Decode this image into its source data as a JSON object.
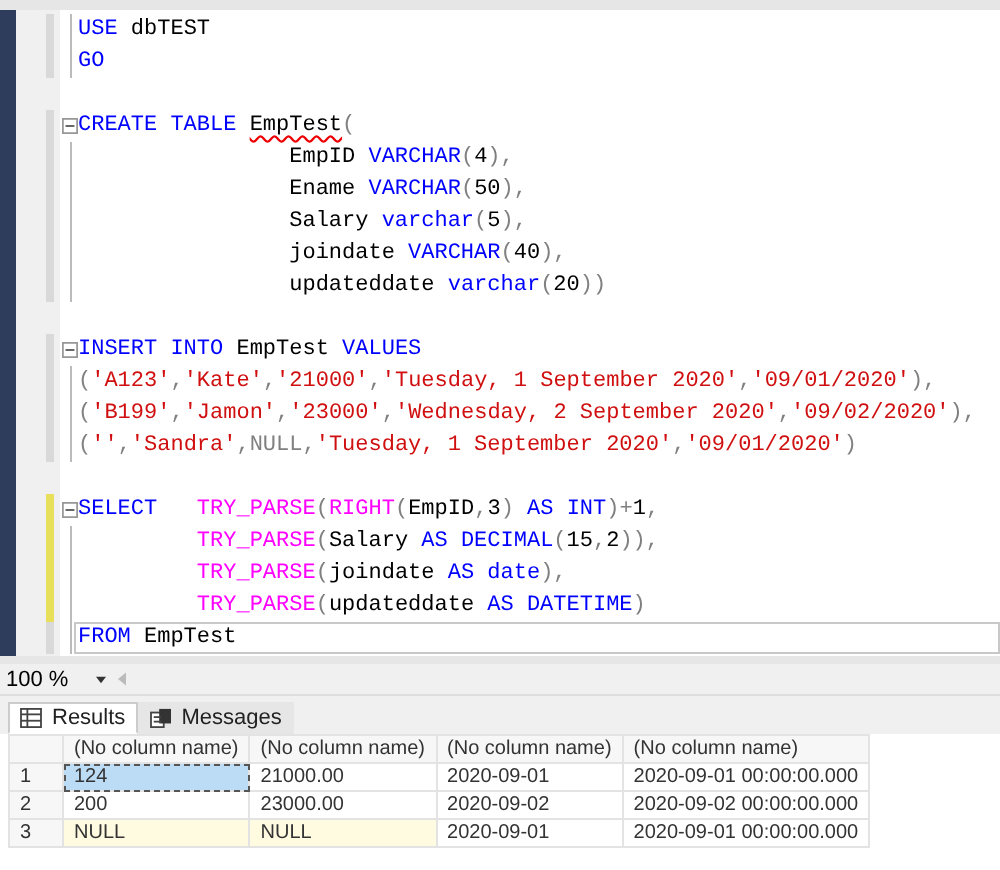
{
  "editor": {
    "blocks": [
      {
        "lines": [
          {
            "fold": false,
            "changed": false,
            "current": false,
            "tokens": [
              {
                "kind": "keyword",
                "text": "USE"
              },
              {
                "kind": "plain",
                "text": " dbTEST"
              }
            ]
          },
          {
            "fold": false,
            "changed": false,
            "current": false,
            "tokens": [
              {
                "kind": "keyword",
                "text": "GO"
              }
            ]
          }
        ]
      },
      {
        "lines": [
          {
            "fold": true,
            "changed": false,
            "current": false,
            "tokens": [
              {
                "kind": "keyword",
                "text": "CREATE TABLE "
              },
              {
                "kind": "error",
                "text": "EmpTest"
              },
              {
                "kind": "operator",
                "text": "("
              }
            ]
          },
          {
            "fold": false,
            "changed": false,
            "current": false,
            "tokens": [
              {
                "kind": "plain",
                "text": "                EmpID "
              },
              {
                "kind": "keyword",
                "text": "VARCHAR"
              },
              {
                "kind": "operator",
                "text": "("
              },
              {
                "kind": "plain",
                "text": "4"
              },
              {
                "kind": "operator",
                "text": "),"
              }
            ]
          },
          {
            "fold": false,
            "changed": false,
            "current": false,
            "tokens": [
              {
                "kind": "plain",
                "text": "                Ename "
              },
              {
                "kind": "keyword",
                "text": "VARCHAR"
              },
              {
                "kind": "operator",
                "text": "("
              },
              {
                "kind": "plain",
                "text": "50"
              },
              {
                "kind": "operator",
                "text": "),"
              }
            ]
          },
          {
            "fold": false,
            "changed": false,
            "current": false,
            "tokens": [
              {
                "kind": "plain",
                "text": "                Salary "
              },
              {
                "kind": "keyword",
                "text": "varchar"
              },
              {
                "kind": "operator",
                "text": "("
              },
              {
                "kind": "plain",
                "text": "5"
              },
              {
                "kind": "operator",
                "text": "),"
              }
            ]
          },
          {
            "fold": false,
            "changed": false,
            "current": false,
            "tokens": [
              {
                "kind": "plain",
                "text": "                joindate "
              },
              {
                "kind": "keyword",
                "text": "VARCHAR"
              },
              {
                "kind": "operator",
                "text": "("
              },
              {
                "kind": "plain",
                "text": "40"
              },
              {
                "kind": "operator",
                "text": "),"
              }
            ]
          },
          {
            "fold": false,
            "changed": false,
            "current": false,
            "tokens": [
              {
                "kind": "plain",
                "text": "                updateddate "
              },
              {
                "kind": "keyword",
                "text": "varchar"
              },
              {
                "kind": "operator",
                "text": "("
              },
              {
                "kind": "plain",
                "text": "20"
              },
              {
                "kind": "operator",
                "text": "))"
              }
            ]
          }
        ]
      },
      {
        "lines": [
          {
            "fold": true,
            "changed": false,
            "current": false,
            "tokens": [
              {
                "kind": "keyword",
                "text": "INSERT INTO"
              },
              {
                "kind": "plain",
                "text": " EmpTest "
              },
              {
                "kind": "keyword",
                "text": "VALUES"
              }
            ]
          },
          {
            "fold": false,
            "changed": false,
            "current": false,
            "tokens": [
              {
                "kind": "operator",
                "text": "("
              },
              {
                "kind": "string",
                "text": "'A123'"
              },
              {
                "kind": "operator",
                "text": ","
              },
              {
                "kind": "string",
                "text": "'Kate'"
              },
              {
                "kind": "operator",
                "text": ","
              },
              {
                "kind": "string",
                "text": "'21000'"
              },
              {
                "kind": "operator",
                "text": ","
              },
              {
                "kind": "string",
                "text": "'Tuesday, 1 September 2020'"
              },
              {
                "kind": "operator",
                "text": ","
              },
              {
                "kind": "string",
                "text": "'09/01/2020'"
              },
              {
                "kind": "operator",
                "text": "),"
              }
            ]
          },
          {
            "fold": false,
            "changed": false,
            "current": false,
            "tokens": [
              {
                "kind": "operator",
                "text": "("
              },
              {
                "kind": "string",
                "text": "'B199'"
              },
              {
                "kind": "operator",
                "text": ","
              },
              {
                "kind": "string",
                "text": "'Jamon'"
              },
              {
                "kind": "operator",
                "text": ","
              },
              {
                "kind": "string",
                "text": "'23000'"
              },
              {
                "kind": "operator",
                "text": ","
              },
              {
                "kind": "string",
                "text": "'Wednesday, 2 September 2020'"
              },
              {
                "kind": "operator",
                "text": ","
              },
              {
                "kind": "string",
                "text": "'09/02/2020'"
              },
              {
                "kind": "operator",
                "text": "),"
              }
            ]
          },
          {
            "fold": false,
            "changed": false,
            "current": false,
            "tokens": [
              {
                "kind": "operator",
                "text": "("
              },
              {
                "kind": "string",
                "text": "''"
              },
              {
                "kind": "operator",
                "text": ","
              },
              {
                "kind": "string",
                "text": "'Sandra'"
              },
              {
                "kind": "operator",
                "text": ",NULL,"
              },
              {
                "kind": "string",
                "text": "'Tuesday, 1 September 2020'"
              },
              {
                "kind": "operator",
                "text": ","
              },
              {
                "kind": "string",
                "text": "'09/01/2020'"
              },
              {
                "kind": "operator",
                "text": ")"
              }
            ]
          }
        ]
      },
      {
        "lines": [
          {
            "fold": true,
            "changed": true,
            "current": false,
            "tokens": [
              {
                "kind": "keyword",
                "text": "SELECT   "
              },
              {
                "kind": "function",
                "text": "TRY_PARSE"
              },
              {
                "kind": "operator",
                "text": "("
              },
              {
                "kind": "function",
                "text": "RIGHT"
              },
              {
                "kind": "operator",
                "text": "("
              },
              {
                "kind": "plain",
                "text": "EmpID"
              },
              {
                "kind": "operator",
                "text": ","
              },
              {
                "kind": "plain",
                "text": "3"
              },
              {
                "kind": "operator",
                "text": ") "
              },
              {
                "kind": "keyword",
                "text": "AS INT"
              },
              {
                "kind": "operator",
                "text": ")+"
              },
              {
                "kind": "plain",
                "text": "1"
              },
              {
                "kind": "operator",
                "text": ","
              }
            ]
          },
          {
            "fold": false,
            "changed": true,
            "current": false,
            "tokens": [
              {
                "kind": "function",
                "text": "         TRY_PARSE"
              },
              {
                "kind": "operator",
                "text": "("
              },
              {
                "kind": "plain",
                "text": "Salary "
              },
              {
                "kind": "keyword",
                "text": "AS DECIMAL"
              },
              {
                "kind": "operator",
                "text": "("
              },
              {
                "kind": "plain",
                "text": "15"
              },
              {
                "kind": "operator",
                "text": ","
              },
              {
                "kind": "plain",
                "text": "2"
              },
              {
                "kind": "operator",
                "text": ")),"
              }
            ]
          },
          {
            "fold": false,
            "changed": true,
            "current": false,
            "tokens": [
              {
                "kind": "function",
                "text": "         TRY_PARSE"
              },
              {
                "kind": "operator",
                "text": "("
              },
              {
                "kind": "plain",
                "text": "joindate "
              },
              {
                "kind": "keyword",
                "text": "AS date"
              },
              {
                "kind": "operator",
                "text": "),"
              }
            ]
          },
          {
            "fold": false,
            "changed": true,
            "current": false,
            "tokens": [
              {
                "kind": "function",
                "text": "         TRY_PARSE"
              },
              {
                "kind": "operator",
                "text": "("
              },
              {
                "kind": "plain",
                "text": "updateddate "
              },
              {
                "kind": "keyword",
                "text": "AS DATETIME"
              },
              {
                "kind": "operator",
                "text": ")"
              }
            ]
          },
          {
            "fold": false,
            "changed": false,
            "current": true,
            "tokens": [
              {
                "kind": "keyword",
                "text": "FROM"
              },
              {
                "kind": "plain",
                "text": " EmpTest"
              }
            ]
          }
        ]
      }
    ]
  },
  "zoom": {
    "value": "100 %"
  },
  "tabs": [
    {
      "label": "Results",
      "selected": true
    },
    {
      "label": "Messages",
      "selected": false
    }
  ],
  "grid": {
    "columns": [
      "(No column name)",
      "(No column name)",
      "(No column name)",
      "(No column name)"
    ],
    "rows": [
      {
        "number": "1",
        "cells": [
          {
            "text": "124",
            "selected": true,
            "kind": "value"
          },
          {
            "text": "21000.00",
            "selected": false,
            "kind": "value"
          },
          {
            "text": "2020-09-01",
            "selected": false,
            "kind": "value"
          },
          {
            "text": "2020-09-01 00:00:00.000",
            "selected": false,
            "kind": "value"
          }
        ]
      },
      {
        "number": "2",
        "cells": [
          {
            "text": "200",
            "selected": false,
            "kind": "value"
          },
          {
            "text": "23000.00",
            "selected": false,
            "kind": "value"
          },
          {
            "text": "2020-09-02",
            "selected": false,
            "kind": "value"
          },
          {
            "text": "2020-09-02 00:00:00.000",
            "selected": false,
            "kind": "value"
          }
        ]
      },
      {
        "number": "3",
        "cells": [
          {
            "text": "NULL",
            "selected": false,
            "kind": "null"
          },
          {
            "text": "NULL",
            "selected": false,
            "kind": "null"
          },
          {
            "text": "2020-09-01",
            "selected": false,
            "kind": "value"
          },
          {
            "text": "2020-09-01 00:00:00.000",
            "selected": false,
            "kind": "value"
          }
        ]
      }
    ]
  }
}
